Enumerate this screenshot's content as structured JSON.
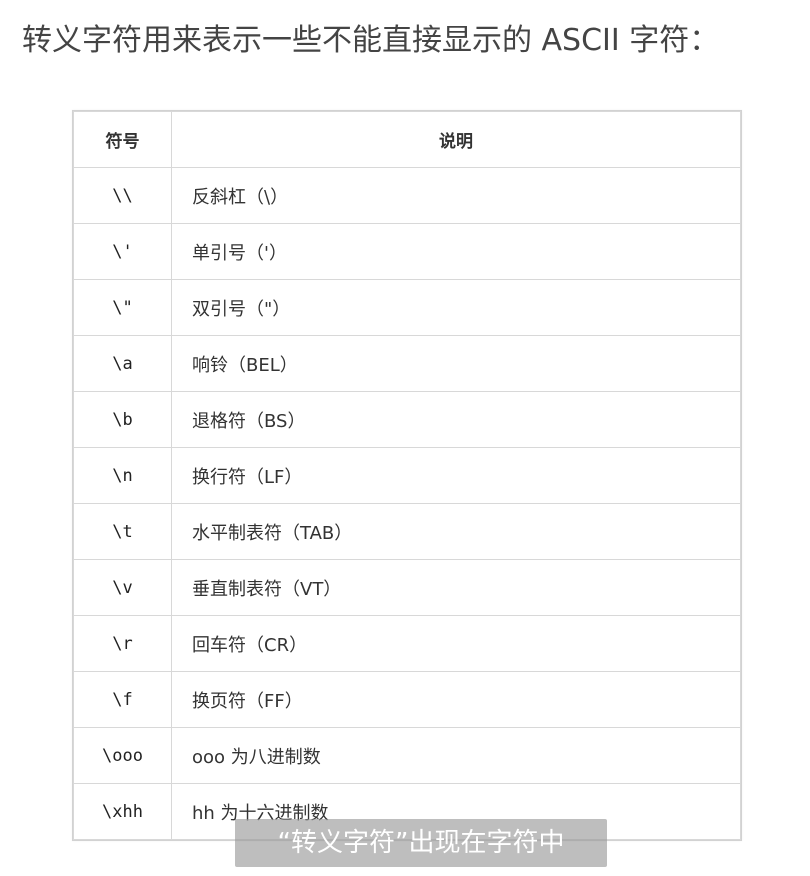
{
  "heading": "转义字符用来表示一些不能直接显示的 ASCII 字符：",
  "table": {
    "headers": [
      "符号",
      "说明"
    ],
    "rows": [
      {
        "symbol": "\\\\",
        "desc": "反斜杠（\\）"
      },
      {
        "symbol": "\\'",
        "desc": "单引号（'）"
      },
      {
        "symbol": "\\\"",
        "desc": "双引号（\"）"
      },
      {
        "symbol": "\\a",
        "desc": "响铃（BEL）"
      },
      {
        "symbol": "\\b",
        "desc": "退格符（BS）"
      },
      {
        "symbol": "\\n",
        "desc": "换行符（LF）"
      },
      {
        "symbol": "\\t",
        "desc": "水平制表符（TAB）"
      },
      {
        "symbol": "\\v",
        "desc": "垂直制表符（VT）"
      },
      {
        "symbol": "\\r",
        "desc": "回车符（CR）"
      },
      {
        "symbol": "\\f",
        "desc": "换页符（FF）"
      },
      {
        "symbol": "\\ooo",
        "desc": "ooo 为八进制数"
      },
      {
        "symbol": "\\xhh",
        "desc": "hh 为十六进制数"
      }
    ]
  },
  "caption": "“转义字符”出现在字符中"
}
